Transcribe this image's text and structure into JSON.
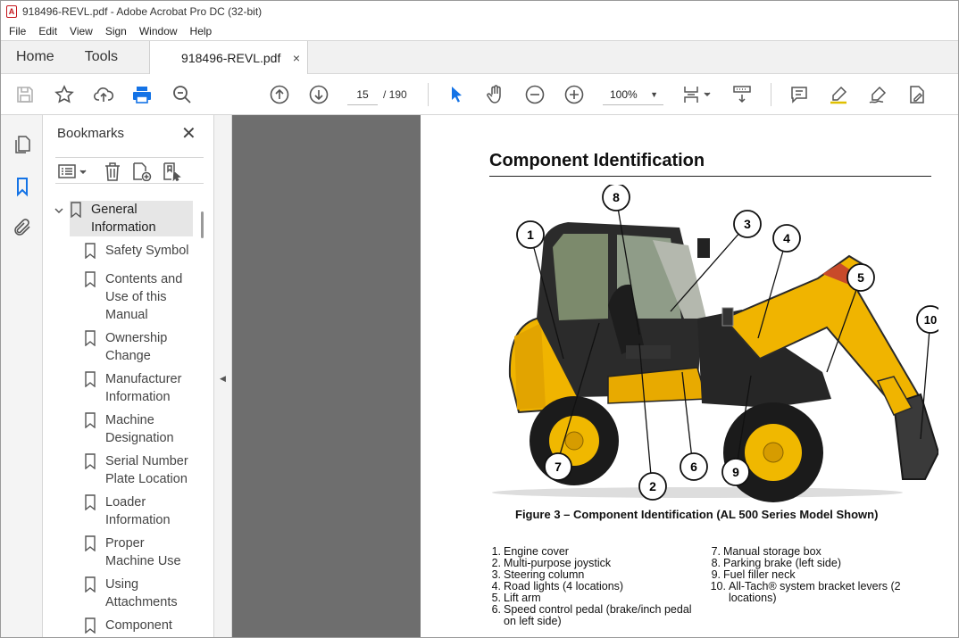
{
  "window": {
    "title": "918496-REVL.pdf - Adobe Acrobat Pro DC (32-bit)"
  },
  "menu": [
    "File",
    "Edit",
    "View",
    "Sign",
    "Window",
    "Help"
  ],
  "tabs": {
    "home": "Home",
    "tools": "Tools",
    "document": "918496-REVL.pdf",
    "close": "×"
  },
  "toolbar": {
    "page_current": "15",
    "page_total": "/ 190",
    "zoom": "100%"
  },
  "bookmarks": {
    "title": "Bookmarks",
    "close": "✕",
    "items": [
      {
        "label": "General Information",
        "line1": "General",
        "line2": "Information"
      },
      {
        "label": "Safety Symbol",
        "line1": "Safety Symbol",
        "line2": ""
      },
      {
        "label": "Contents and Use of this Manual",
        "line1": "Contents and",
        "line2": "Use of this",
        "line3": "Manual"
      },
      {
        "label": "Ownership Change",
        "line1": "Ownership",
        "line2": "Change"
      },
      {
        "label": "Manufacturer Information",
        "line1": "Manufacturer",
        "line2": "Information"
      },
      {
        "label": "Machine Designation",
        "line1": "Machine",
        "line2": "Designation"
      },
      {
        "label": "Serial Number Plate Location",
        "line1": "Serial Number",
        "line2": "Plate Location"
      },
      {
        "label": "Loader Information",
        "line1": "Loader",
        "line2": "Information"
      },
      {
        "label": "Proper Machine Use",
        "line1": "Proper",
        "line2": "Machine Use"
      },
      {
        "label": "Using Attachments",
        "line1": "Using",
        "line2": "Attachments"
      },
      {
        "label": "Component",
        "line1": "Component",
        "line2": ""
      }
    ]
  },
  "document": {
    "title": "Component Identification",
    "caption": "Figure 3 – Component Identification (AL 500 Series Model Shown)",
    "callouts": [
      "1",
      "2",
      "3",
      "4",
      "5",
      "6",
      "7",
      "8",
      "9",
      "10"
    ],
    "legend_left": [
      {
        "num": "1.",
        "text": "Engine cover"
      },
      {
        "num": "2.",
        "text": "Multi-purpose joystick"
      },
      {
        "num": "3.",
        "text": "Steering column"
      },
      {
        "num": "4.",
        "text": "Road lights (4 locations)"
      },
      {
        "num": "5.",
        "text": "Lift arm"
      },
      {
        "num": "6.",
        "text": "Speed control pedal (brake/inch pedal",
        "text2": "on left side)"
      }
    ],
    "legend_right": [
      {
        "num": "7.",
        "text": "Manual storage box"
      },
      {
        "num": "8.",
        "text": "Parking brake (left side)"
      },
      {
        "num": "9.",
        "text": "Fuel filler neck"
      },
      {
        "num": "10.",
        "text": "All-Tach® system bracket levers (2",
        "text2": "locations)"
      }
    ]
  }
}
